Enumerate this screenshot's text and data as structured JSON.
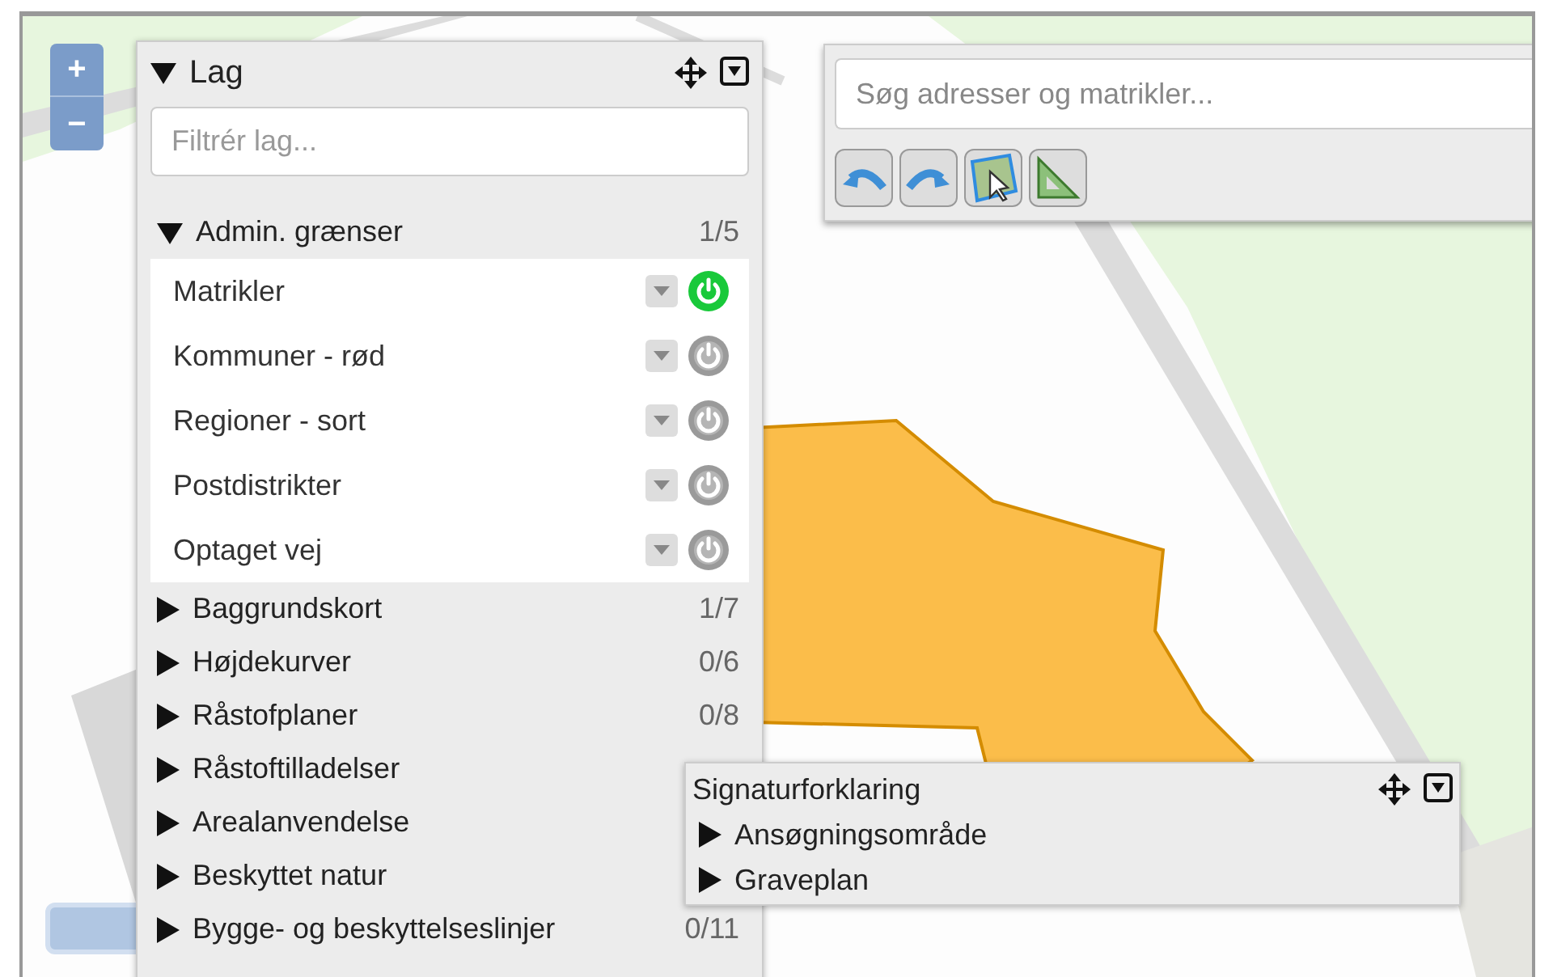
{
  "zoom_controls": {
    "zoom_in": "+",
    "zoom_out": "−"
  },
  "layers_panel": {
    "title": "Lag",
    "expanded": true,
    "filter": {
      "placeholder": "Filtrér lag..."
    },
    "groups": [
      {
        "name": "Admin. grænser",
        "count": "1/5",
        "expanded": true,
        "layers": [
          {
            "name": "Matrikler",
            "on": true
          },
          {
            "name": "Kommuner - rød",
            "on": false
          },
          {
            "name": "Regioner - sort",
            "on": false
          },
          {
            "name": "Postdistrikter",
            "on": false
          },
          {
            "name": "Optaget vej",
            "on": false
          }
        ]
      },
      {
        "name": "Baggrundskort",
        "count": "1/7",
        "expanded": false
      },
      {
        "name": "Højdekurver",
        "count": "0/6",
        "expanded": false
      },
      {
        "name": "Råstofplaner",
        "count": "0/8",
        "expanded": false
      },
      {
        "name": "Råstoftilladelser",
        "expanded": false
      },
      {
        "name": "Arealanvendelse",
        "expanded": false
      },
      {
        "name": "Beskyttet natur",
        "expanded": false
      },
      {
        "name": "Bygge- og beskyttelseslinjer",
        "count": "0/11",
        "expanded": false
      }
    ]
  },
  "search_panel": {
    "placeholder": "Søg adresser og matrikler..."
  },
  "legend": {
    "title": "Signaturforklaring",
    "expanded": true,
    "items": [
      {
        "name": "Ansøgningsområde",
        "expanded": false
      },
      {
        "name": "Graveplan",
        "expanded": false
      }
    ]
  }
}
